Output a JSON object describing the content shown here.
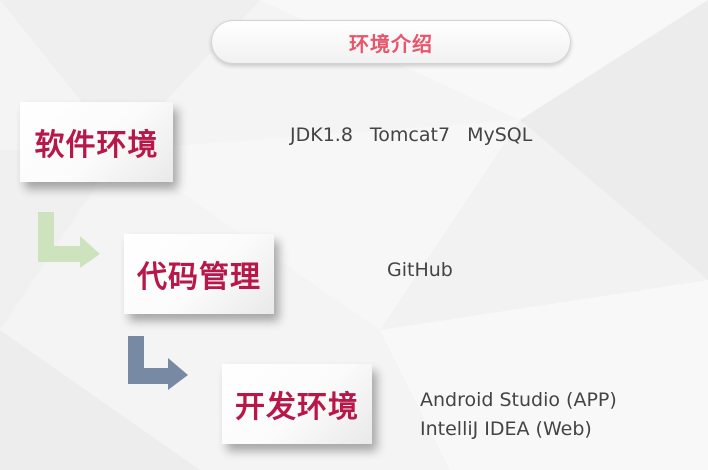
{
  "header": {
    "title": "环境介绍"
  },
  "sections": [
    {
      "label": "软件环境",
      "items": [
        "JDK1.8",
        "Tomcat7",
        "MySQL"
      ]
    },
    {
      "label": "代码管理",
      "items": [
        "GitHub"
      ]
    },
    {
      "label": "开发环境",
      "items": [
        "Android Studio (APP)",
        "IntelliJ IDEA (Web)"
      ]
    }
  ],
  "colors": {
    "title_text": "#e8546a",
    "card_label": "#b71849",
    "arrow_1": "#cde3bd",
    "arrow_2": "#7889a3",
    "info_text": "#444444"
  }
}
